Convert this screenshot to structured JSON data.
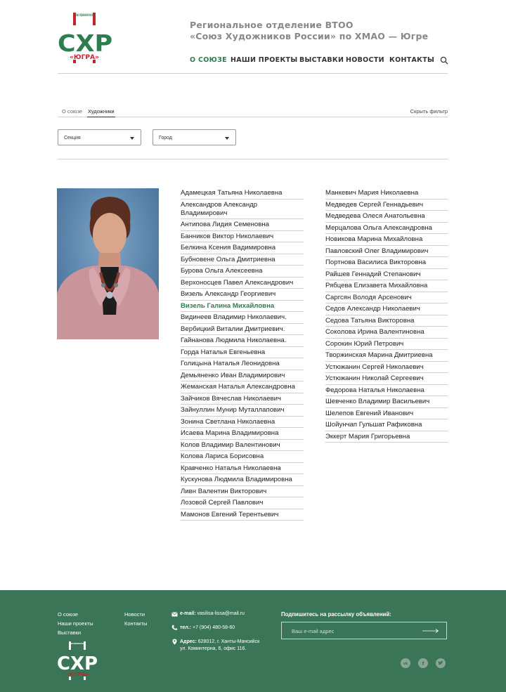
{
  "header": {
    "logo": {
      "small_text": "СОЮЗ ХУДОЖНИКОВ РОССИИ",
      "main": "СХР",
      "sub": "«ЮГРА»"
    },
    "title_line1": "Региональное отделение ВТОО",
    "title_line2": "«Союз Художников России» по ХМАО — Югре",
    "nav": [
      {
        "label": "О СОЮЗЕ",
        "active": true
      },
      {
        "label": "НАШИ ПРОЕКТЫ"
      },
      {
        "label": "ВЫСТАВКИ"
      },
      {
        "label": "НОВОСТИ"
      },
      {
        "label": "КОНТАКТЫ"
      }
    ]
  },
  "tabs": {
    "about": "О союзе",
    "artists": "Художники",
    "hide_filter": "Скрыть фильтр"
  },
  "filters": {
    "section": "Секция",
    "city": "Город"
  },
  "artists_left": [
    "Адамецкая Татьяна Николаевна",
    "Александров Александр Владимирович",
    "Антипова Лидия Семеновна",
    "Банников Виктор Николаевич",
    "Белкина Ксения Вадимировна",
    "Бубновене Ольга Дмитриевна",
    "Бурова Ольга Алексеевна",
    "Верхоносцев Павел Александрович",
    "Визель Александр Георгиевич",
    "Визель Галина Михайловна",
    "Видинеев Владимир Николаевич.",
    "Вербицкий Виталии Дмитриевич.",
    "Гайнанова Людмила Николаевна.",
    "Горда Наталья Евгеньевна",
    "Голицына Наталья Леонидовна",
    "Демьяненко Иван Владимирович",
    "Жеманская Наталья Александровна",
    "Зайчиков Вячеслав Николаевич",
    "Зайнуллин Мунир Муталлапович",
    "Зонина Светлана Николаевна",
    "Исаева Марина Владимировна",
    "Колов Владимир Валентинович",
    "Колова Лариса Борисовна",
    "Кравченко Наталья Николаевна",
    "Кускунова Людмила Владимировна",
    "Ливн Валентин Викторович",
    "Лозовой Сергей Павлович",
    "Мамонов Евгений Терентьевич"
  ],
  "selected_artist": "Визель Галина Михайловна",
  "artists_right": [
    "Манкевич Мария Николаевна",
    "Медведев Сергей Геннадьевич",
    "Медведева Олеся Анатольевна",
    "Мерцалова Ольга Александровна",
    "Новикова Марина Михайловна",
    "Павловский Олег Владимирович",
    "Портнова Василиса Викторовна",
    "Райшев Геннадий Степанович",
    "Рябцева Елизавета Михайловна",
    "Саргсян Володя Арсенович",
    "Седов Александр Николаевич",
    "Седова Татьяна Викторовна",
    "Соколова Ирина Валентиновна",
    "Сорокин Юрий Петрович",
    "Творжинская Марина Дмитриевна",
    "Устюжанин Сергей Николаевич",
    "Устюжанин Николай Сергеевич",
    "Федорова Наталья Николаевна",
    "Шевченко Владимир Васильевич",
    "Шелепов Евгений Иванович",
    "Шойунчап Гульшат Рафиковна",
    "Эккерт Мария Григорьевна"
  ],
  "footer": {
    "links_col1": [
      "О союзе",
      "Наши проекты",
      "Выставки"
    ],
    "links_col2": [
      "Новости",
      "Контакты"
    ],
    "email_label": "e-mail:",
    "email": "vasilisa-lissa@mail.ru",
    "phone_label": "тел.:",
    "phone": "+7 (904) 480-58-60",
    "address_label": "Адрес:",
    "address_line1": "628012, г. Ханты-Мансийск",
    "address_line2": "ул. Коминтерна, 6, офис 116.",
    "subscribe_title": "Подпишитесь на рассылку объявлений:",
    "email_placeholder": "Ваш e-mail адрес"
  },
  "colors": {
    "brand_green": "#2e7d4f",
    "brand_red": "#c8232c",
    "footer_bg": "#3a7557"
  }
}
